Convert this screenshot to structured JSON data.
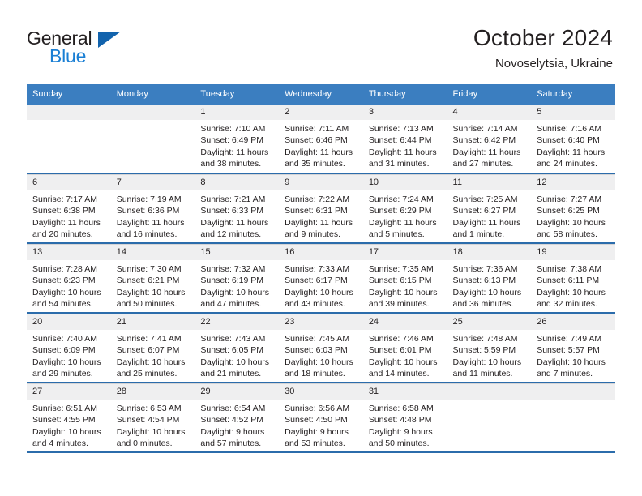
{
  "brand": {
    "name_part1": "General",
    "name_part2": "Blue",
    "accent_color": "#1a7fd4",
    "triangle_color": "#1263ad"
  },
  "header": {
    "title": "October 2024",
    "subtitle": "Novoselytsia, Ukraine"
  },
  "theme": {
    "header_row_bg": "#3b7ec0",
    "row_divider": "#2b6cab",
    "daynum_bg": "#efeff0"
  },
  "weekdays": [
    "Sunday",
    "Monday",
    "Tuesday",
    "Wednesday",
    "Thursday",
    "Friday",
    "Saturday"
  ],
  "labels": {
    "sunrise": "Sunrise:",
    "sunset": "Sunset:",
    "daylight": "Daylight:"
  },
  "weeks": [
    [
      {
        "day": "",
        "empty": true
      },
      {
        "day": "",
        "empty": true
      },
      {
        "day": "1",
        "sunrise": "Sunrise: 7:10 AM",
        "sunset": "Sunset: 6:49 PM",
        "daylight_1": "Daylight: 11 hours",
        "daylight_2": "and 38 minutes."
      },
      {
        "day": "2",
        "sunrise": "Sunrise: 7:11 AM",
        "sunset": "Sunset: 6:46 PM",
        "daylight_1": "Daylight: 11 hours",
        "daylight_2": "and 35 minutes."
      },
      {
        "day": "3",
        "sunrise": "Sunrise: 7:13 AM",
        "sunset": "Sunset: 6:44 PM",
        "daylight_1": "Daylight: 11 hours",
        "daylight_2": "and 31 minutes."
      },
      {
        "day": "4",
        "sunrise": "Sunrise: 7:14 AM",
        "sunset": "Sunset: 6:42 PM",
        "daylight_1": "Daylight: 11 hours",
        "daylight_2": "and 27 minutes."
      },
      {
        "day": "5",
        "sunrise": "Sunrise: 7:16 AM",
        "sunset": "Sunset: 6:40 PM",
        "daylight_1": "Daylight: 11 hours",
        "daylight_2": "and 24 minutes."
      }
    ],
    [
      {
        "day": "6",
        "sunrise": "Sunrise: 7:17 AM",
        "sunset": "Sunset: 6:38 PM",
        "daylight_1": "Daylight: 11 hours",
        "daylight_2": "and 20 minutes."
      },
      {
        "day": "7",
        "sunrise": "Sunrise: 7:19 AM",
        "sunset": "Sunset: 6:36 PM",
        "daylight_1": "Daylight: 11 hours",
        "daylight_2": "and 16 minutes."
      },
      {
        "day": "8",
        "sunrise": "Sunrise: 7:21 AM",
        "sunset": "Sunset: 6:33 PM",
        "daylight_1": "Daylight: 11 hours",
        "daylight_2": "and 12 minutes."
      },
      {
        "day": "9",
        "sunrise": "Sunrise: 7:22 AM",
        "sunset": "Sunset: 6:31 PM",
        "daylight_1": "Daylight: 11 hours",
        "daylight_2": "and 9 minutes."
      },
      {
        "day": "10",
        "sunrise": "Sunrise: 7:24 AM",
        "sunset": "Sunset: 6:29 PM",
        "daylight_1": "Daylight: 11 hours",
        "daylight_2": "and 5 minutes."
      },
      {
        "day": "11",
        "sunrise": "Sunrise: 7:25 AM",
        "sunset": "Sunset: 6:27 PM",
        "daylight_1": "Daylight: 11 hours",
        "daylight_2": "and 1 minute."
      },
      {
        "day": "12",
        "sunrise": "Sunrise: 7:27 AM",
        "sunset": "Sunset: 6:25 PM",
        "daylight_1": "Daylight: 10 hours",
        "daylight_2": "and 58 minutes."
      }
    ],
    [
      {
        "day": "13",
        "sunrise": "Sunrise: 7:28 AM",
        "sunset": "Sunset: 6:23 PM",
        "daylight_1": "Daylight: 10 hours",
        "daylight_2": "and 54 minutes."
      },
      {
        "day": "14",
        "sunrise": "Sunrise: 7:30 AM",
        "sunset": "Sunset: 6:21 PM",
        "daylight_1": "Daylight: 10 hours",
        "daylight_2": "and 50 minutes."
      },
      {
        "day": "15",
        "sunrise": "Sunrise: 7:32 AM",
        "sunset": "Sunset: 6:19 PM",
        "daylight_1": "Daylight: 10 hours",
        "daylight_2": "and 47 minutes."
      },
      {
        "day": "16",
        "sunrise": "Sunrise: 7:33 AM",
        "sunset": "Sunset: 6:17 PM",
        "daylight_1": "Daylight: 10 hours",
        "daylight_2": "and 43 minutes."
      },
      {
        "day": "17",
        "sunrise": "Sunrise: 7:35 AM",
        "sunset": "Sunset: 6:15 PM",
        "daylight_1": "Daylight: 10 hours",
        "daylight_2": "and 39 minutes."
      },
      {
        "day": "18",
        "sunrise": "Sunrise: 7:36 AM",
        "sunset": "Sunset: 6:13 PM",
        "daylight_1": "Daylight: 10 hours",
        "daylight_2": "and 36 minutes."
      },
      {
        "day": "19",
        "sunrise": "Sunrise: 7:38 AM",
        "sunset": "Sunset: 6:11 PM",
        "daylight_1": "Daylight: 10 hours",
        "daylight_2": "and 32 minutes."
      }
    ],
    [
      {
        "day": "20",
        "sunrise": "Sunrise: 7:40 AM",
        "sunset": "Sunset: 6:09 PM",
        "daylight_1": "Daylight: 10 hours",
        "daylight_2": "and 29 minutes."
      },
      {
        "day": "21",
        "sunrise": "Sunrise: 7:41 AM",
        "sunset": "Sunset: 6:07 PM",
        "daylight_1": "Daylight: 10 hours",
        "daylight_2": "and 25 minutes."
      },
      {
        "day": "22",
        "sunrise": "Sunrise: 7:43 AM",
        "sunset": "Sunset: 6:05 PM",
        "daylight_1": "Daylight: 10 hours",
        "daylight_2": "and 21 minutes."
      },
      {
        "day": "23",
        "sunrise": "Sunrise: 7:45 AM",
        "sunset": "Sunset: 6:03 PM",
        "daylight_1": "Daylight: 10 hours",
        "daylight_2": "and 18 minutes."
      },
      {
        "day": "24",
        "sunrise": "Sunrise: 7:46 AM",
        "sunset": "Sunset: 6:01 PM",
        "daylight_1": "Daylight: 10 hours",
        "daylight_2": "and 14 minutes."
      },
      {
        "day": "25",
        "sunrise": "Sunrise: 7:48 AM",
        "sunset": "Sunset: 5:59 PM",
        "daylight_1": "Daylight: 10 hours",
        "daylight_2": "and 11 minutes."
      },
      {
        "day": "26",
        "sunrise": "Sunrise: 7:49 AM",
        "sunset": "Sunset: 5:57 PM",
        "daylight_1": "Daylight: 10 hours",
        "daylight_2": "and 7 minutes."
      }
    ],
    [
      {
        "day": "27",
        "sunrise": "Sunrise: 6:51 AM",
        "sunset": "Sunset: 4:55 PM",
        "daylight_1": "Daylight: 10 hours",
        "daylight_2": "and 4 minutes."
      },
      {
        "day": "28",
        "sunrise": "Sunrise: 6:53 AM",
        "sunset": "Sunset: 4:54 PM",
        "daylight_1": "Daylight: 10 hours",
        "daylight_2": "and 0 minutes."
      },
      {
        "day": "29",
        "sunrise": "Sunrise: 6:54 AM",
        "sunset": "Sunset: 4:52 PM",
        "daylight_1": "Daylight: 9 hours",
        "daylight_2": "and 57 minutes."
      },
      {
        "day": "30",
        "sunrise": "Sunrise: 6:56 AM",
        "sunset": "Sunset: 4:50 PM",
        "daylight_1": "Daylight: 9 hours",
        "daylight_2": "and 53 minutes."
      },
      {
        "day": "31",
        "sunrise": "Sunrise: 6:58 AM",
        "sunset": "Sunset: 4:48 PM",
        "daylight_1": "Daylight: 9 hours",
        "daylight_2": "and 50 minutes."
      },
      {
        "day": "",
        "empty": true
      },
      {
        "day": "",
        "empty": true
      }
    ]
  ]
}
